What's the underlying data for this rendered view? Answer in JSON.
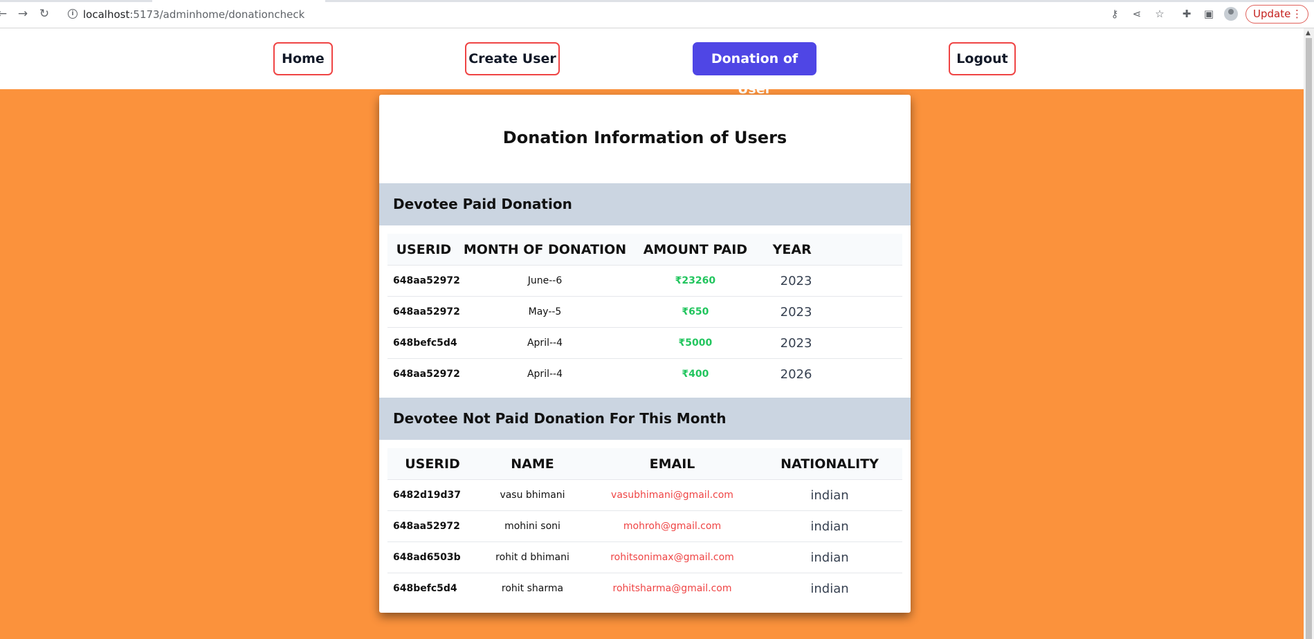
{
  "browser": {
    "url_host": "localhost",
    "url_path": ":5173/adminhome/donationcheck",
    "update_label": "Update"
  },
  "nav": {
    "home": "Home",
    "create_user": "Create User",
    "donation_of_user": "Donation of User",
    "logout": "Logout"
  },
  "card": {
    "title": "Donation Information of Users",
    "paid_section": "Devotee Paid Donation",
    "not_paid_section": "Devotee Not Paid Donation For This Month"
  },
  "paid_table": {
    "headers": [
      "USERID",
      "MONTH OF DONATION",
      "AMOUNT PAID",
      "YEAR"
    ],
    "rows": [
      {
        "userid": "648aa52972",
        "month": "June--6",
        "amount": "₹23260",
        "year": "2023"
      },
      {
        "userid": "648aa52972",
        "month": "May--5",
        "amount": "₹650",
        "year": "2023"
      },
      {
        "userid": "648befc5d4",
        "month": "April--4",
        "amount": "₹5000",
        "year": "2023"
      },
      {
        "userid": "648aa52972",
        "month": "April--4",
        "amount": "₹400",
        "year": "2026"
      }
    ]
  },
  "unpaid_table": {
    "headers": [
      "USERID",
      "NAME",
      "EMAIL",
      "NATIONALITY"
    ],
    "rows": [
      {
        "userid": "6482d19d37",
        "name": "vasu bhimani",
        "email": "vasubhimani@gmail.com",
        "nationality": "indian"
      },
      {
        "userid": "648aa52972",
        "name": "mohini soni",
        "email": "mohroh@gmail.com",
        "nationality": "indian"
      },
      {
        "userid": "648ad6503b",
        "name": "rohit d bhimani",
        "email": "rohitsonimax@gmail.com",
        "nationality": "indian"
      },
      {
        "userid": "648befc5d4",
        "name": "rohit sharma",
        "email": "rohitsharma@gmail.com",
        "nationality": "indian"
      }
    ]
  },
  "colors": {
    "page_bg": "#fb923c",
    "active_nav": "#4f46e5",
    "nav_border": "#ef4444",
    "amount": "#22c55e",
    "email": "#ef4444",
    "section_bg": "#cbd5e1"
  }
}
